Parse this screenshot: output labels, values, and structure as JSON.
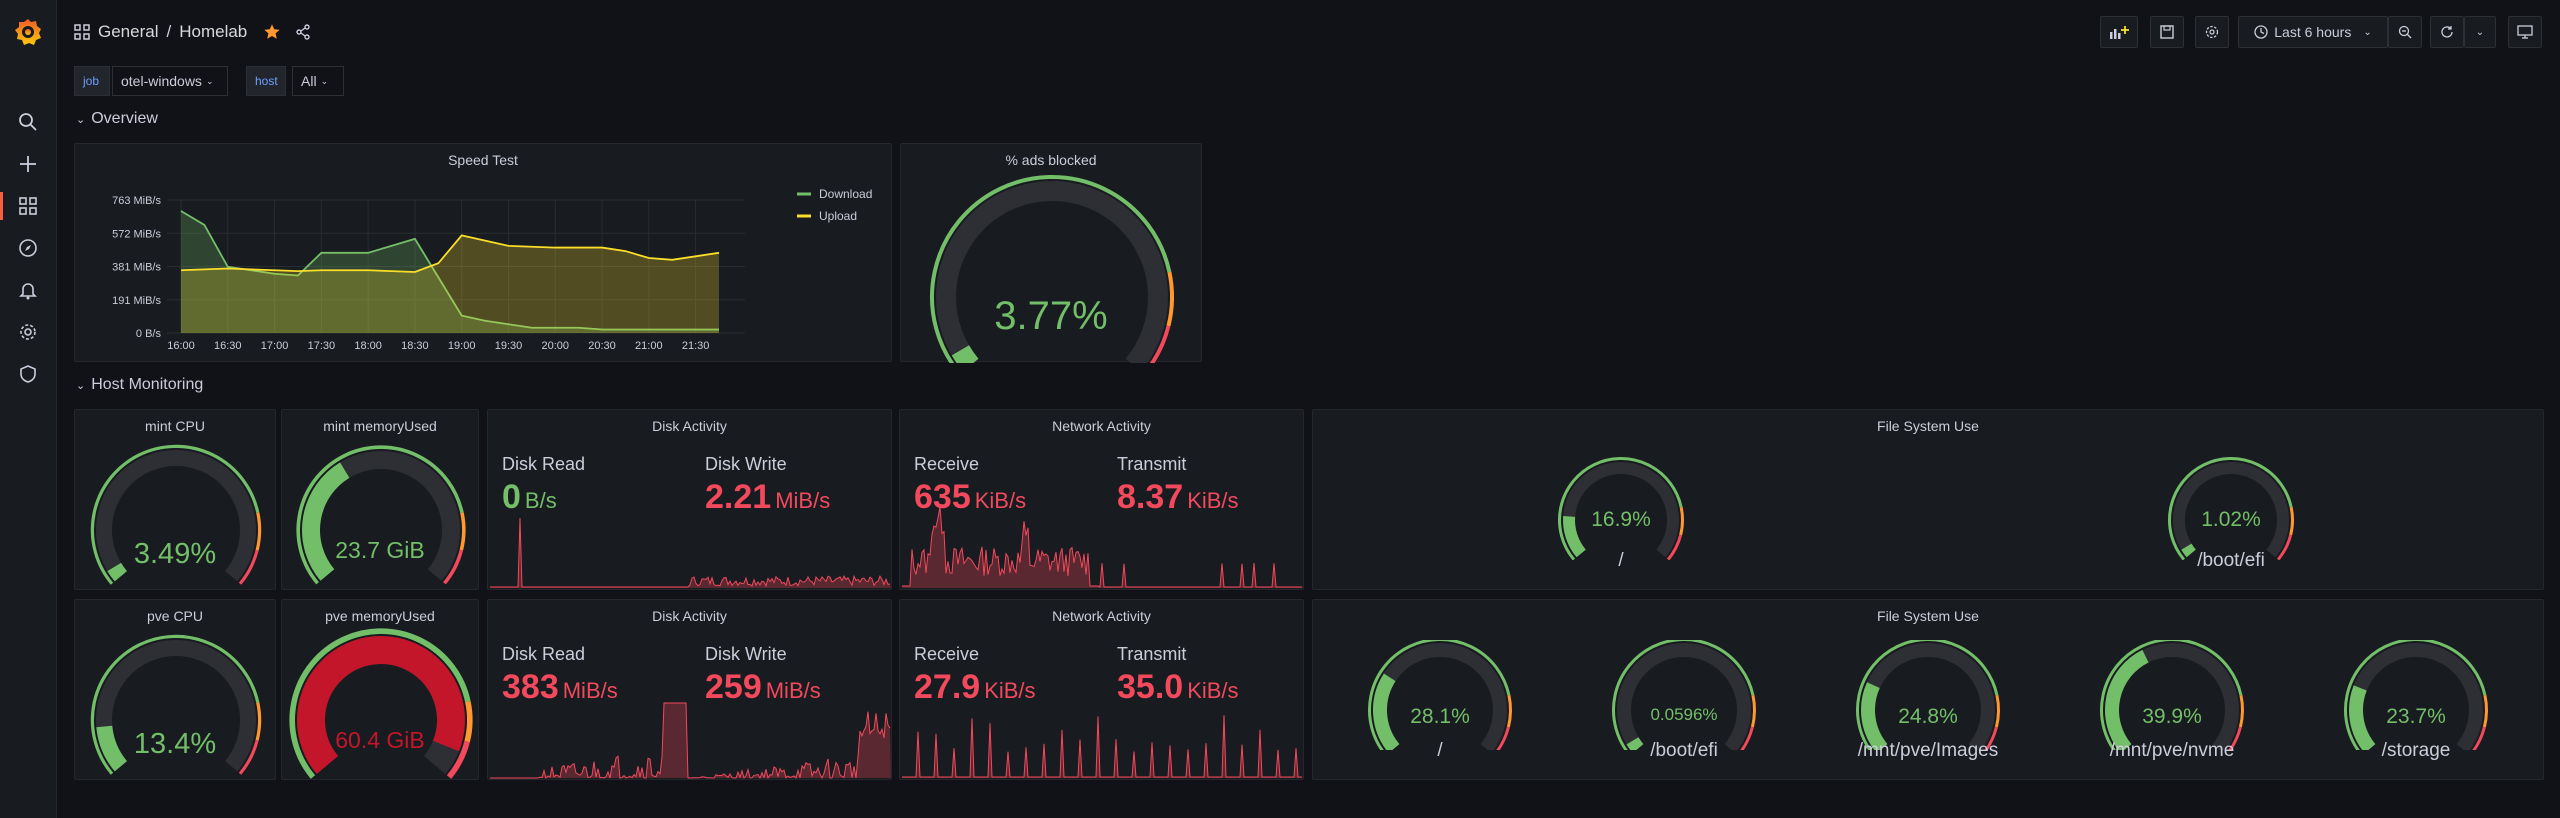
{
  "breadcrumb": {
    "folder": "General",
    "dashboard": "Homelab"
  },
  "toolbar": {
    "time_range": "Last 6 hours"
  },
  "variables": [
    {
      "label": "job",
      "value": "otel-windows"
    },
    {
      "label": "host",
      "value": "All"
    }
  ],
  "rows": {
    "overview": "Overview",
    "host_monitoring": "Host Monitoring"
  },
  "colors": {
    "green": "#73bf69",
    "red": "#f2495c",
    "yellow": "#fade2a",
    "orange": "#ff9830",
    "dark_red": "#c4162a"
  },
  "speed_test": {
    "title": "Speed Test",
    "chart_data": {
      "type": "area",
      "x": [
        "16:00",
        "16:15",
        "16:30",
        "16:45",
        "17:00",
        "17:15",
        "17:30",
        "17:45",
        "18:00",
        "18:15",
        "18:30",
        "18:45",
        "19:00",
        "19:15",
        "19:30",
        "19:45",
        "20:00",
        "20:15",
        "20:30",
        "20:45",
        "21:00",
        "21:15",
        "21:30",
        "21:45"
      ],
      "xticks": [
        "16:00",
        "16:30",
        "17:00",
        "17:30",
        "18:00",
        "18:30",
        "19:00",
        "19:30",
        "20:00",
        "20:30",
        "21:00",
        "21:30"
      ],
      "yticks": [
        "763 MiB/s",
        "572 MiB/s",
        "381 MiB/s",
        "191 MiB/s",
        "0 B/s"
      ],
      "ylim": [
        0,
        763
      ],
      "series": [
        {
          "name": "Download",
          "color": "#73bf69",
          "values": [
            700,
            620,
            380,
            360,
            340,
            330,
            460,
            460,
            460,
            500,
            540,
            320,
            100,
            70,
            50,
            30,
            30,
            30,
            20,
            20,
            20,
            20,
            20,
            20
          ]
        },
        {
          "name": "Upload",
          "color": "#fade2a",
          "values": [
            360,
            365,
            370,
            365,
            360,
            355,
            360,
            360,
            360,
            355,
            350,
            400,
            560,
            530,
            500,
            495,
            490,
            490,
            490,
            470,
            430,
            420,
            440,
            460
          ]
        }
      ],
      "legend": "top-right"
    }
  },
  "ads_blocked": {
    "title": "% ads blocked",
    "value": "3.77%",
    "fraction": 0.0377
  },
  "host_rows": [
    {
      "cpu": {
        "title": "mint CPU",
        "value": "3.49%",
        "fraction": 0.0349,
        "color": "#73bf69"
      },
      "mem": {
        "title": "mint memoryUsed",
        "value": "23.7 GiB",
        "fraction": 0.38,
        "color": "#73bf69"
      },
      "disk": {
        "title": "Disk Activity",
        "read_label": "Disk Read",
        "read_value": "0",
        "read_unit": "B/s",
        "read_color": "#73bf69",
        "write_label": "Disk Write",
        "write_value": "2.21",
        "write_unit": "MiB/s",
        "write_color": "#f2495c"
      },
      "net": {
        "title": "Network Activity",
        "rx_label": "Receive",
        "rx_value": "635",
        "rx_unit": "KiB/s",
        "tx_label": "Transmit",
        "tx_value": "8.37",
        "tx_unit": "KiB/s",
        "color": "#f2495c"
      },
      "fs": {
        "title": "File System Use",
        "items": [
          {
            "value": "16.9%",
            "fraction": 0.169,
            "label": "/"
          },
          {
            "value": "1.02%",
            "fraction": 0.0102,
            "label": "/boot/efi"
          }
        ]
      }
    },
    {
      "cpu": {
        "title": "pve CPU",
        "value": "13.4%",
        "fraction": 0.134,
        "color": "#73bf69"
      },
      "mem": {
        "title": "pve memoryUsed",
        "value": "60.4 GiB",
        "fraction": 0.93,
        "color": "#c4162a"
      },
      "disk": {
        "title": "Disk Activity",
        "read_label": "Disk Read",
        "read_value": "383",
        "read_unit": "MiB/s",
        "read_color": "#f2495c",
        "write_label": "Disk Write",
        "write_value": "259",
        "write_unit": "MiB/s",
        "write_color": "#f2495c"
      },
      "net": {
        "title": "Network Activity",
        "rx_label": "Receive",
        "rx_value": "27.9",
        "rx_unit": "KiB/s",
        "tx_label": "Transmit",
        "tx_value": "35.0",
        "tx_unit": "KiB/s",
        "color": "#f2495c"
      },
      "fs": {
        "title": "File System Use",
        "items": [
          {
            "value": "28.1%",
            "fraction": 0.281,
            "label": "/"
          },
          {
            "value": "0.0596%",
            "fraction": 0.0006,
            "label": "/boot/efi"
          },
          {
            "value": "24.8%",
            "fraction": 0.248,
            "label": "/mnt/pve/Images"
          },
          {
            "value": "39.9%",
            "fraction": 0.399,
            "label": "/mnt/pve/nvme"
          },
          {
            "value": "23.7%",
            "fraction": 0.237,
            "label": "/storage"
          }
        ]
      }
    }
  ]
}
